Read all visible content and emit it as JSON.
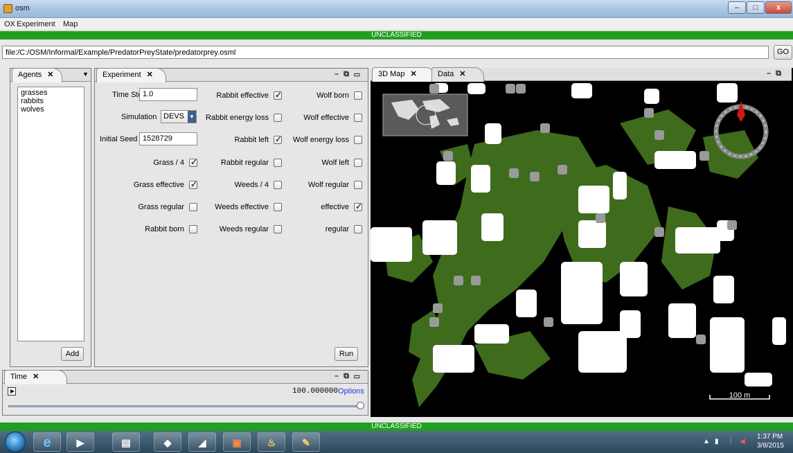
{
  "window": {
    "title": "osm",
    "min_label": "–",
    "max_label": "□",
    "close_label": "x"
  },
  "menu": [
    "OX",
    "Experiment",
    "Map"
  ],
  "classification": "UNCLASSIFIED",
  "address": {
    "value": "file:/C:/OSM/Informal/Example/PredatorPreyState/predatorprey.osml",
    "go_label": "GO"
  },
  "agents_panel": {
    "tab_label": "Agents",
    "items": [
      "grasses",
      "rabbits",
      "wolves"
    ],
    "add_label": "Add"
  },
  "experiment_panel": {
    "tab_label": "Experiment",
    "time_step_label": "Time Step",
    "time_step_value": "1.0",
    "simulation_label": "Simulation",
    "simulation_value": "DEVS",
    "initial_seed_label": "Initial Seed",
    "initial_seed_value": "1528729",
    "checkboxes_col1": [
      {
        "label": "Grass / 4",
        "checked": true
      },
      {
        "label": "Grass effective",
        "checked": true
      },
      {
        "label": "Grass regular",
        "checked": false
      },
      {
        "label": "Rabbit born",
        "checked": false
      }
    ],
    "checkboxes_col2": [
      {
        "label": "Rabbit effective",
        "checked": true
      },
      {
        "label": "Rabbit energy loss",
        "checked": false
      },
      {
        "label": "Rabbit left",
        "checked": true
      },
      {
        "label": "Rabbit regular",
        "checked": false
      },
      {
        "label": "Weeds / 4",
        "checked": false
      },
      {
        "label": "Weeds effective",
        "checked": false
      },
      {
        "label": "Weeds regular",
        "checked": false
      }
    ],
    "checkboxes_col3": [
      {
        "label": "Wolf born",
        "checked": false
      },
      {
        "label": "Wolf effective",
        "checked": false
      },
      {
        "label": "Wolf energy loss",
        "checked": false
      },
      {
        "label": "Wolf left",
        "checked": false
      },
      {
        "label": "Wolf regular",
        "checked": false
      },
      {
        "label": "effective",
        "checked": true
      },
      {
        "label": "regular",
        "checked": false
      }
    ],
    "run_label": "Run"
  },
  "time_panel": {
    "tab_label": "Time",
    "time_value": "100.000000",
    "options_label": "Options"
  },
  "map_panel": {
    "tabs": [
      "3D Map",
      "Data"
    ],
    "scale_label": "100 m"
  },
  "taskbar": {
    "time": "1:37 PM",
    "date": "3/8/2015"
  },
  "colors": {
    "classification_green": "#1fa01f",
    "grass_green": "#3f6b1c",
    "map_background": "#000000"
  }
}
